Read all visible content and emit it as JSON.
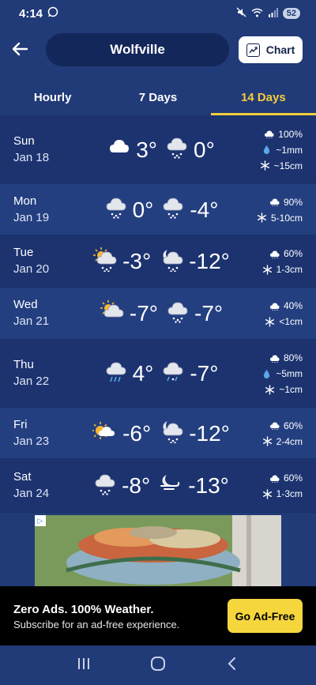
{
  "status_bar": {
    "time": "4:14",
    "battery": "52"
  },
  "header": {
    "city": "Wolfville",
    "chart_label": "Chart"
  },
  "tabs": [
    {
      "label": "Hourly",
      "active": false
    },
    {
      "label": "7 Days",
      "active": false
    },
    {
      "label": "14 Days",
      "active": true
    }
  ],
  "days": [
    {
      "name": "Sun",
      "date": "Jan 18",
      "icon_day": "cloudy-icon",
      "high": "3°",
      "icon_night": "snow-icon",
      "low": "0°",
      "precip": [
        {
          "icon": "cloud-icon",
          "text": "100%"
        },
        {
          "icon": "rain-drop-icon",
          "text": "~1mm"
        },
        {
          "icon": "snowflake-icon",
          "text": "~15cm"
        }
      ]
    },
    {
      "name": "Mon",
      "date": "Jan 19",
      "icon_day": "snow-icon",
      "high": "0°",
      "icon_night": "snow-icon",
      "low": "-4°",
      "precip": [
        {
          "icon": "cloud-icon",
          "text": "90%"
        },
        {
          "icon": "snowflake-icon",
          "text": "5-10cm"
        }
      ]
    },
    {
      "name": "Tue",
      "date": "Jan 20",
      "icon_day": "sun-cloud-snow-icon",
      "high": "-3°",
      "icon_night": "moon-cloud-snow-icon",
      "low": "-12°",
      "precip": [
        {
          "icon": "cloud-icon",
          "text": "60%"
        },
        {
          "icon": "snowflake-icon",
          "text": "1-3cm"
        }
      ]
    },
    {
      "name": "Wed",
      "date": "Jan 21",
      "icon_day": "partly-cloudy-icon",
      "high": "-7°",
      "icon_night": "snow-icon",
      "low": "-7°",
      "precip": [
        {
          "icon": "cloud-icon",
          "text": "40%"
        },
        {
          "icon": "snowflake-icon",
          "text": "<1cm"
        }
      ]
    },
    {
      "name": "Thu",
      "date": "Jan 22",
      "icon_day": "rain-icon",
      "high": "4°",
      "icon_night": "sleet-icon",
      "low": "-7°",
      "precip": [
        {
          "icon": "cloud-icon",
          "text": "80%"
        },
        {
          "icon": "rain-drop-icon",
          "text": "~5mm"
        },
        {
          "icon": "snowflake-icon",
          "text": "~1cm"
        }
      ]
    },
    {
      "name": "Fri",
      "date": "Jan 23",
      "icon_day": "sun-cloud-icon",
      "high": "-6°",
      "icon_night": "moon-cloud-snow-icon",
      "low": "-12°",
      "precip": [
        {
          "icon": "cloud-icon",
          "text": "60%"
        },
        {
          "icon": "snowflake-icon",
          "text": "2-4cm"
        }
      ]
    },
    {
      "name": "Sat",
      "date": "Jan 24",
      "icon_day": "snow-icon",
      "high": "-8°",
      "icon_night": "moon-wind-icon",
      "low": "-13°",
      "precip": [
        {
          "icon": "cloud-icon",
          "text": "60%"
        },
        {
          "icon": "snowflake-icon",
          "text": "1-3cm"
        }
      ]
    }
  ],
  "promo": {
    "title": "Zero Ads. 100% Weather.",
    "subtitle": "Subscribe for an ad-free experience.",
    "button": "Go Ad-Free"
  },
  "colors": {
    "accent": "#f5cc3b",
    "background": "#213a78",
    "promo_button": "#f5d63d"
  }
}
